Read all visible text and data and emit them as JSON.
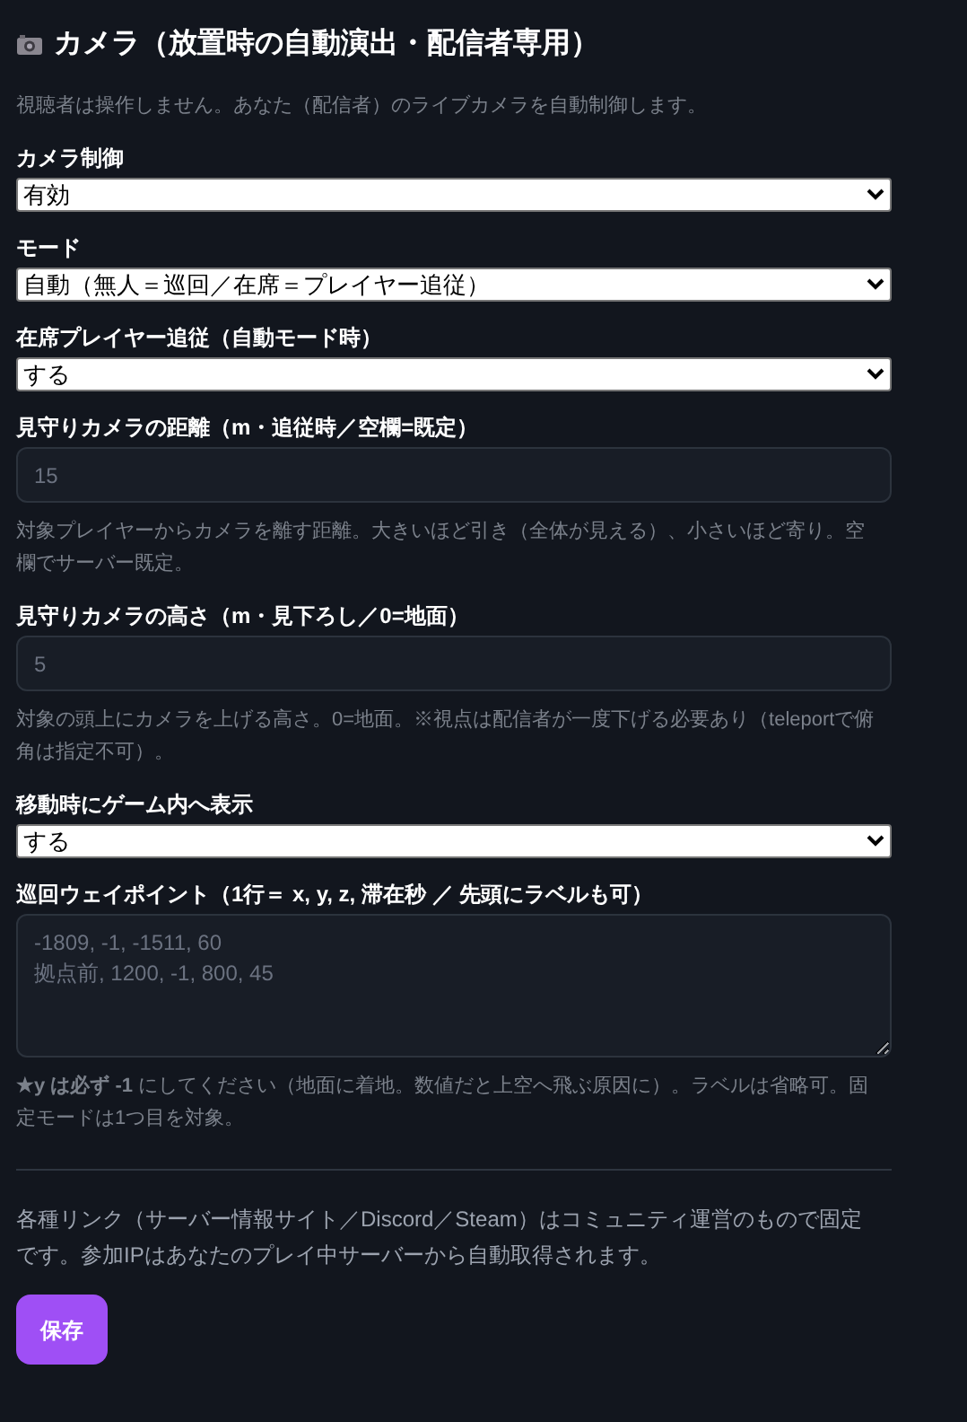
{
  "section": {
    "title": "カメラ（放置時の自動演出・配信者専用）",
    "description": "視聴者は操作しません。あなた（配信者）のライブカメラを自動制御します。"
  },
  "fields": [
    {
      "kind": "select",
      "label": "カメラ制御",
      "value": "有効"
    },
    {
      "kind": "select",
      "label": "モード",
      "value": "自動（無人＝巡回／在席＝プレイヤー追従）"
    },
    {
      "kind": "select",
      "label": "在席プレイヤー追従（自動モード時）",
      "value": "する"
    },
    {
      "kind": "input",
      "label": "見守りカメラの距離（m・追従時／空欄=既定）",
      "placeholder": "15",
      "hint": "対象プレイヤーからカメラを離す距離。大きいほど引き（全体が見える）、小さいほど寄り。空欄でサーバー既定。"
    },
    {
      "kind": "input",
      "label": "見守りカメラの高さ（m・見下ろし／0=地面）",
      "placeholder": "5",
      "hint": "対象の頭上にカメラを上げる高さ。0=地面。※視点は配信者が一度下げる必要あり（teleportで俯角は指定不可）。"
    },
    {
      "kind": "select",
      "label": "移動時にゲーム内へ表示",
      "value": "する"
    },
    {
      "kind": "textarea",
      "label": "巡回ウェイポイント（1行＝ x, y, z, 滞在秒 ／ 先頭にラベルも可）",
      "placeholder": "-1809, -1, -1511, 60\n拠点前, 1200, -1, 800, 45",
      "hint": "**★y は必ず -1** にしてください（地面に着地。数値だと上空へ飛ぶ原因に）。ラベルは省略可。固定モードは1つ目を対象。"
    }
  ],
  "note": "各種リンク（サーバー情報サイト／Discord／Steam）はコミュニティ運営のもので固定です。参加IPはあなたのプレイ中サーバーから自動取得されます。",
  "save_button": "保存"
}
